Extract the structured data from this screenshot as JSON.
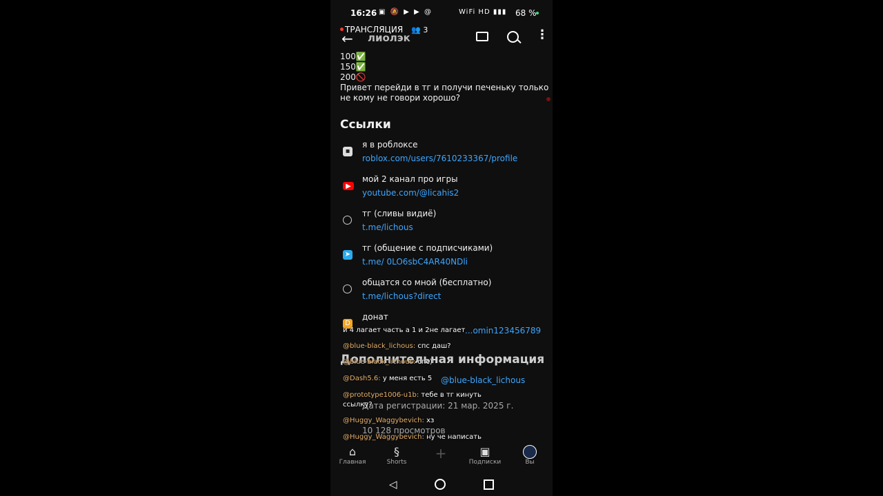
{
  "status_bar": {
    "time": "16:26",
    "battery": "68 %",
    "left_icons": "▣ 🔕 ▶ ▶ @",
    "right_icons": "WiFi HD ▮▮▮"
  },
  "top_bar": {
    "title": "лиолэк",
    "live_label": "ТРАНСЛЯЦИЯ",
    "viewers": "3",
    "back_icon": "arrow-left",
    "more_icon": "more-vertical"
  },
  "description": {
    "lines": [
      "100✅",
      "150✅",
      "200🚫",
      "Привет перейди в тг и получи печеньку только",
      "не кому не говори хорошо?"
    ]
  },
  "links_section": {
    "title": "Ссылки",
    "items": [
      {
        "name": "я в роблоксе",
        "url": "roblox.com/users/7610233367/profile",
        "icon": "roblox-icon"
      },
      {
        "name": "мой 2 канал про игры",
        "url": "youtube.com/@licahis2",
        "icon": "youtube-icon"
      },
      {
        "name": "тг (сливы видиё)",
        "url": "t.me/lichous",
        "icon": "globe-icon"
      },
      {
        "name": "тг (общение с подписчиками)",
        "url": "t.me/ 0LO6sbC4AR40NDli",
        "icon": "telegram-icon"
      },
      {
        "name": "общатся со мной (бесплатно)",
        "url": "t.me/lichous?direct",
        "icon": "globe-icon"
      },
      {
        "name": "донат",
        "url": "...omin123456789",
        "icon": "donationalerts-icon"
      }
    ]
  },
  "additional_section": {
    "title": "Дополнительная информация",
    "handle": "@blue-black_lichous",
    "registration": "Дата регистрации: 21 мар. 2025 г.",
    "views": "10 128 просмотров"
  },
  "chat": [
    {
      "user": "",
      "text": "и 4 лагает часть а 1 и 2не лагает"
    },
    {
      "user": "@blue-black_lichous:",
      "text": "спс даш?"
    },
    {
      "user": "@blue-black_lichous:",
      "text": "спс)"
    },
    {
      "user": "@Dash5.6:",
      "text": "у меня есть 5"
    },
    {
      "user": "@prototype1006-u1b:",
      "text": "тебе в тг кинуть"
    },
    {
      "user": "",
      "text": "ссылку?"
    },
    {
      "user": "@Huggy_Waggybevich:",
      "text": "хз"
    },
    {
      "user": "@Huggy_Waggybevich:",
      "text": "ну че написать"
    }
  ],
  "bottom_nav": [
    {
      "label": "Главная",
      "icon": "home-icon"
    },
    {
      "label": "Shorts",
      "icon": "shorts-icon"
    },
    {
      "label": "",
      "icon": "plus-icon"
    },
    {
      "label": "Подписки",
      "icon": "subscriptions-icon"
    },
    {
      "label": "Вы",
      "icon": "avatar-icon"
    }
  ]
}
